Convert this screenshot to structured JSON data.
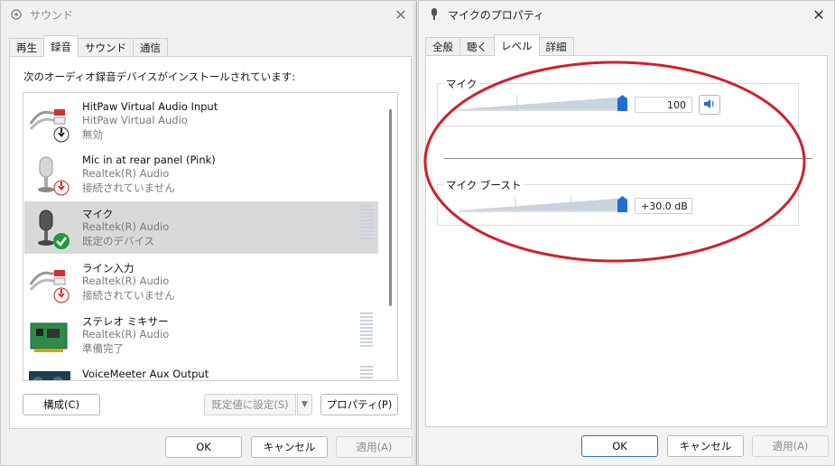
{
  "sound_window": {
    "title": "サウンド",
    "tabs": [
      {
        "label": "再生",
        "active": false
      },
      {
        "label": "録音",
        "active": true
      },
      {
        "label": "サウンド",
        "active": false
      },
      {
        "label": "通信",
        "active": false
      }
    ],
    "instruction": "次のオーディオ録音デバイスがインストールされています:",
    "devices": [
      {
        "name": "HitPaw Virtual Audio Input",
        "driver": "HitPaw Virtual Audio",
        "status": "無効",
        "icon": "cable-icon",
        "badge": "down-arrow-black"
      },
      {
        "name": "Mic in at rear panel (Pink)",
        "driver": "Realtek(R) Audio",
        "status": "接続されていません",
        "icon": "microphone-icon",
        "badge": "down-arrow-red"
      },
      {
        "name": "マイク",
        "driver": "Realtek(R) Audio",
        "status": "既定のデバイス",
        "icon": "microphone-icon",
        "badge": "check-green"
      },
      {
        "name": "ライン入力",
        "driver": "Realtek(R) Audio",
        "status": "接続されていません",
        "icon": "cable-icon",
        "badge": "down-arrow-red"
      },
      {
        "name": "ステレオ ミキサー",
        "driver": "Realtek(R) Audio",
        "status": "準備完了",
        "icon": "circuit-board-icon",
        "badge": ""
      },
      {
        "name": "VoiceMeeter Aux Output",
        "driver": "",
        "status": "",
        "icon": "voicemeeter-icon",
        "badge": ""
      }
    ],
    "buttons": {
      "configure": "構成(C)",
      "set_default": "既定値に設定(S)",
      "properties": "プロパティ(P)",
      "ok": "OK",
      "cancel": "キャンセル",
      "apply": "適用(A)"
    }
  },
  "props_window": {
    "title": "マイクのプロパティ",
    "tabs": [
      {
        "label": "全般",
        "active": false
      },
      {
        "label": "聴く",
        "active": false
      },
      {
        "label": "レベル",
        "active": true
      },
      {
        "label": "詳細",
        "active": false
      }
    ],
    "mic_group": {
      "label": "マイク",
      "value": "100",
      "level_percent": 100,
      "mute_icon": "speaker-icon"
    },
    "boost_group": {
      "label": "マイク ブースト",
      "value": "+30.0 dB",
      "level_percent": 100
    },
    "buttons": {
      "ok": "OK",
      "cancel": "キャンセル",
      "apply": "適用(A)"
    }
  },
  "colors": {
    "accent": "#1f6fd1",
    "annotation": "#d0202a",
    "selection": "#d9d9d9"
  }
}
